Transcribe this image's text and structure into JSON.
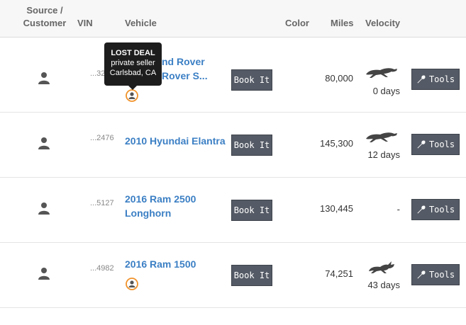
{
  "header": {
    "source_customer_line1": "Source /",
    "source_customer_line2": "Customer",
    "vin": "VIN",
    "vehicle": "Vehicle",
    "color": "Color",
    "miles": "Miles",
    "velocity": "Velocity"
  },
  "tooltip": {
    "title": "LOST DEAL",
    "line1": "private seller",
    "line2": "Carlsbad, CA"
  },
  "rows": [
    {
      "vin": "...32",
      "vehicle_line1": "nd Rover",
      "vehicle_line2": "Rover S...",
      "book_label": "Book It",
      "miles": "80,000",
      "velocity_days": "0 days",
      "velocity_icon": "cheetah-icon",
      "tools_label": "Tools"
    },
    {
      "vin": "...2476",
      "vehicle_line1": "2010 Hyundai Elantra",
      "book_label": "Book It",
      "miles": "145,300",
      "velocity_days": "12 days",
      "velocity_icon": "cheetah-icon",
      "tools_label": "Tools"
    },
    {
      "vin": "...5127",
      "vehicle_line1": "2016 Ram 2500",
      "vehicle_line2": "Longhorn",
      "book_label": "Book It",
      "miles": "130,445",
      "velocity_days": "-",
      "tools_label": "Tools"
    },
    {
      "vin": "...4982",
      "vehicle_line1": "2016 Ram 1500",
      "book_label": "Book It",
      "miles": "74,251",
      "velocity_days": "43 days",
      "velocity_icon": "rabbit-icon",
      "tools_label": "Tools"
    }
  ],
  "colors": {
    "link": "#3b7fc4",
    "button": "#555b66",
    "lead_icon": "#f0922b"
  }
}
